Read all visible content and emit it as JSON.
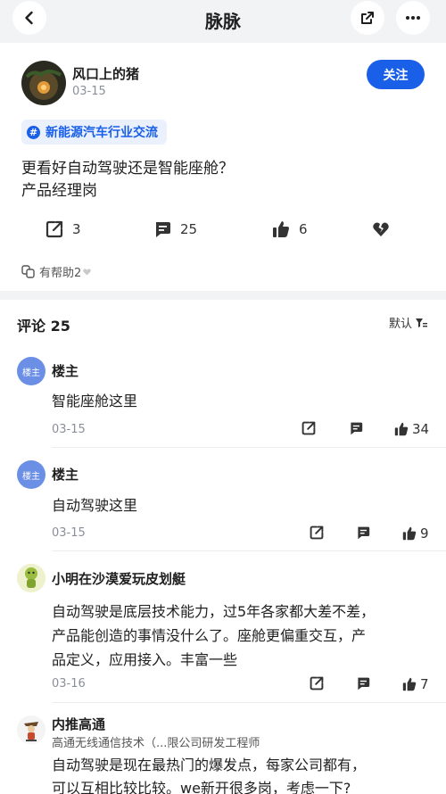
{
  "header": {
    "title": "脉脉"
  },
  "post": {
    "author": "风口上的猪",
    "date": "03-15",
    "follow_label": "关注",
    "topic": "新能源汽车行业交流",
    "lines": [
      "更看好自动驾驶还是智能座舱？",
      "产品经理岗"
    ],
    "actions": {
      "share": "3",
      "comments": "25",
      "likes": "6"
    },
    "helpful": "有帮助2"
  },
  "comments_section": {
    "title": "评论 25",
    "sort_label": "默认",
    "items": [
      {
        "badge": "楼主",
        "name": "楼主",
        "text": [
          "智能座舱这里"
        ],
        "date": "03-15",
        "likes": "34"
      },
      {
        "badge": "楼主",
        "name": "楼主",
        "text": [
          "自动驾驶这里"
        ],
        "date": "03-15",
        "likes": "9"
      },
      {
        "name": "小明在沙漠爱玩皮划艇",
        "text": [
          "自动驾驶是底层技术能力，过5年各家都大差不差，",
          "产品能创造的事情没什么了。座舱更偏重交互，产",
          "品定义，应用接入。丰富一些"
        ],
        "date": "03-16",
        "likes": "7"
      },
      {
        "name": "内推高通",
        "subtitle": "高通无线通信技术（...限公司研发工程师",
        "text": [
          "自动驾驶是现在最热门的爆发点，每家公司都有，",
          "可以互相比较比较。we新开很多岗，考虑一下?"
        ]
      }
    ]
  },
  "colors": {
    "accent": "#1a5fe8",
    "topic_bg": "#eaf1fd",
    "page_bg": "#f2f3f5"
  }
}
